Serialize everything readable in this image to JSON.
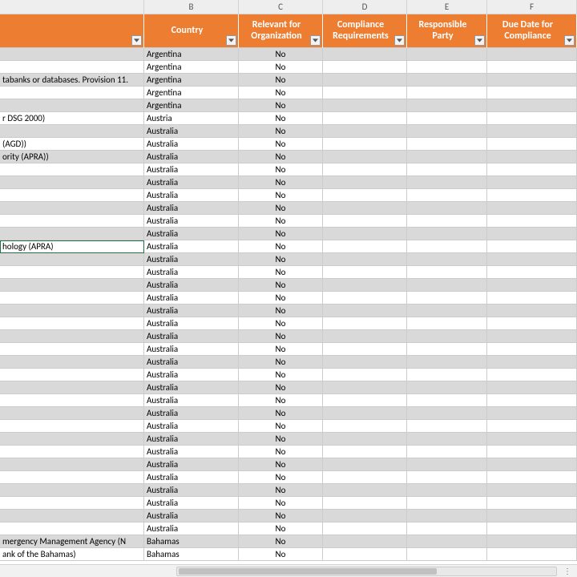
{
  "columns": [
    "B",
    "C",
    "D",
    "E",
    "F"
  ],
  "headers": {
    "a": "",
    "b": "Country",
    "c": "Relevant for Organization",
    "d": "Compliance Requirements",
    "e": "Responsible Party",
    "f": "Due Date for Compliance"
  },
  "accent_color": "#ED7D31",
  "alt_row_color": "#d9d9d9",
  "selected_row_index": 15,
  "rows": [
    {
      "a": "",
      "b": "Argentina",
      "c": "No",
      "d": "",
      "e": "",
      "f": ""
    },
    {
      "a": "",
      "b": "Argentina",
      "c": "No",
      "d": "",
      "e": "",
      "f": ""
    },
    {
      "a": "tabanks or databases. Provision 11.",
      "b": "Argentina",
      "c": "No",
      "d": "",
      "e": "",
      "f": ""
    },
    {
      "a": "",
      "b": "Argentina",
      "c": "No",
      "d": "",
      "e": "",
      "f": ""
    },
    {
      "a": "",
      "b": "Argentina",
      "c": "No",
      "d": "",
      "e": "",
      "f": ""
    },
    {
      "a": "r DSG 2000)",
      "b": "Austria",
      "c": "No",
      "d": "",
      "e": "",
      "f": ""
    },
    {
      "a": "",
      "b": "Australia",
      "c": "No",
      "d": "",
      "e": "",
      "f": ""
    },
    {
      "a": " (AGD))",
      "b": "Australia",
      "c": "No",
      "d": "",
      "e": "",
      "f": ""
    },
    {
      "a": "ority (APRA))",
      "b": "Australia",
      "c": "No",
      "d": "",
      "e": "",
      "f": ""
    },
    {
      "a": "",
      "b": "Australia",
      "c": "No",
      "d": "",
      "e": "",
      "f": ""
    },
    {
      "a": "",
      "b": "Australia",
      "c": "No",
      "d": "",
      "e": "",
      "f": ""
    },
    {
      "a": "",
      "b": "Australia",
      "c": "No",
      "d": "",
      "e": "",
      "f": ""
    },
    {
      "a": "",
      "b": "Australia",
      "c": "No",
      "d": "",
      "e": "",
      "f": ""
    },
    {
      "a": "",
      "b": "Australia",
      "c": "No",
      "d": "",
      "e": "",
      "f": ""
    },
    {
      "a": "",
      "b": "Australia",
      "c": "No",
      "d": "",
      "e": "",
      "f": ""
    },
    {
      "a": "hology (APRA)",
      "b": "Australia",
      "c": "No",
      "d": "",
      "e": "",
      "f": ""
    },
    {
      "a": "",
      "b": "Australia",
      "c": "No",
      "d": "",
      "e": "",
      "f": ""
    },
    {
      "a": "",
      "b": "Australia",
      "c": "No",
      "d": "",
      "e": "",
      "f": ""
    },
    {
      "a": "",
      "b": "Australia",
      "c": "No",
      "d": "",
      "e": "",
      "f": ""
    },
    {
      "a": "",
      "b": "Australia",
      "c": "No",
      "d": "",
      "e": "",
      "f": ""
    },
    {
      "a": "",
      "b": "Australia",
      "c": "No",
      "d": "",
      "e": "",
      "f": ""
    },
    {
      "a": "",
      "b": "Australia",
      "c": "No",
      "d": "",
      "e": "",
      "f": ""
    },
    {
      "a": "",
      "b": "Australia",
      "c": "No",
      "d": "",
      "e": "",
      "f": ""
    },
    {
      "a": "",
      "b": "Australia",
      "c": "No",
      "d": "",
      "e": "",
      "f": ""
    },
    {
      "a": "",
      "b": "Australia",
      "c": "No",
      "d": "",
      "e": "",
      "f": ""
    },
    {
      "a": "",
      "b": "Australia",
      "c": "No",
      "d": "",
      "e": "",
      "f": ""
    },
    {
      "a": "",
      "b": "Australia",
      "c": "No",
      "d": "",
      "e": "",
      "f": ""
    },
    {
      "a": "",
      "b": "Australia",
      "c": "No",
      "d": "",
      "e": "",
      "f": ""
    },
    {
      "a": "",
      "b": "Australia",
      "c": "No",
      "d": "",
      "e": "",
      "f": ""
    },
    {
      "a": "",
      "b": "Australia",
      "c": "No",
      "d": "",
      "e": "",
      "f": ""
    },
    {
      "a": "",
      "b": "Australia",
      "c": "No",
      "d": "",
      "e": "",
      "f": ""
    },
    {
      "a": "",
      "b": "Australia",
      "c": "No",
      "d": "",
      "e": "",
      "f": ""
    },
    {
      "a": "",
      "b": "Australia",
      "c": "No",
      "d": "",
      "e": "",
      "f": ""
    },
    {
      "a": "",
      "b": "Australia",
      "c": "No",
      "d": "",
      "e": "",
      "f": ""
    },
    {
      "a": "",
      "b": "Australia",
      "c": "No",
      "d": "",
      "e": "",
      "f": ""
    },
    {
      "a": "",
      "b": "Australia",
      "c": "No",
      "d": "",
      "e": "",
      "f": ""
    },
    {
      "a": "",
      "b": "Australia",
      "c": "No",
      "d": "",
      "e": "",
      "f": ""
    },
    {
      "a": "",
      "b": "Australia",
      "c": "No",
      "d": "",
      "e": "",
      "f": ""
    },
    {
      "a": "mergency Management Agency (N",
      "b": "Bahamas",
      "c": "No",
      "d": "",
      "e": "",
      "f": ""
    },
    {
      "a": "ank of the Bahamas)",
      "b": "Bahamas",
      "c": "No",
      "d": "",
      "e": "",
      "f": ""
    }
  ]
}
